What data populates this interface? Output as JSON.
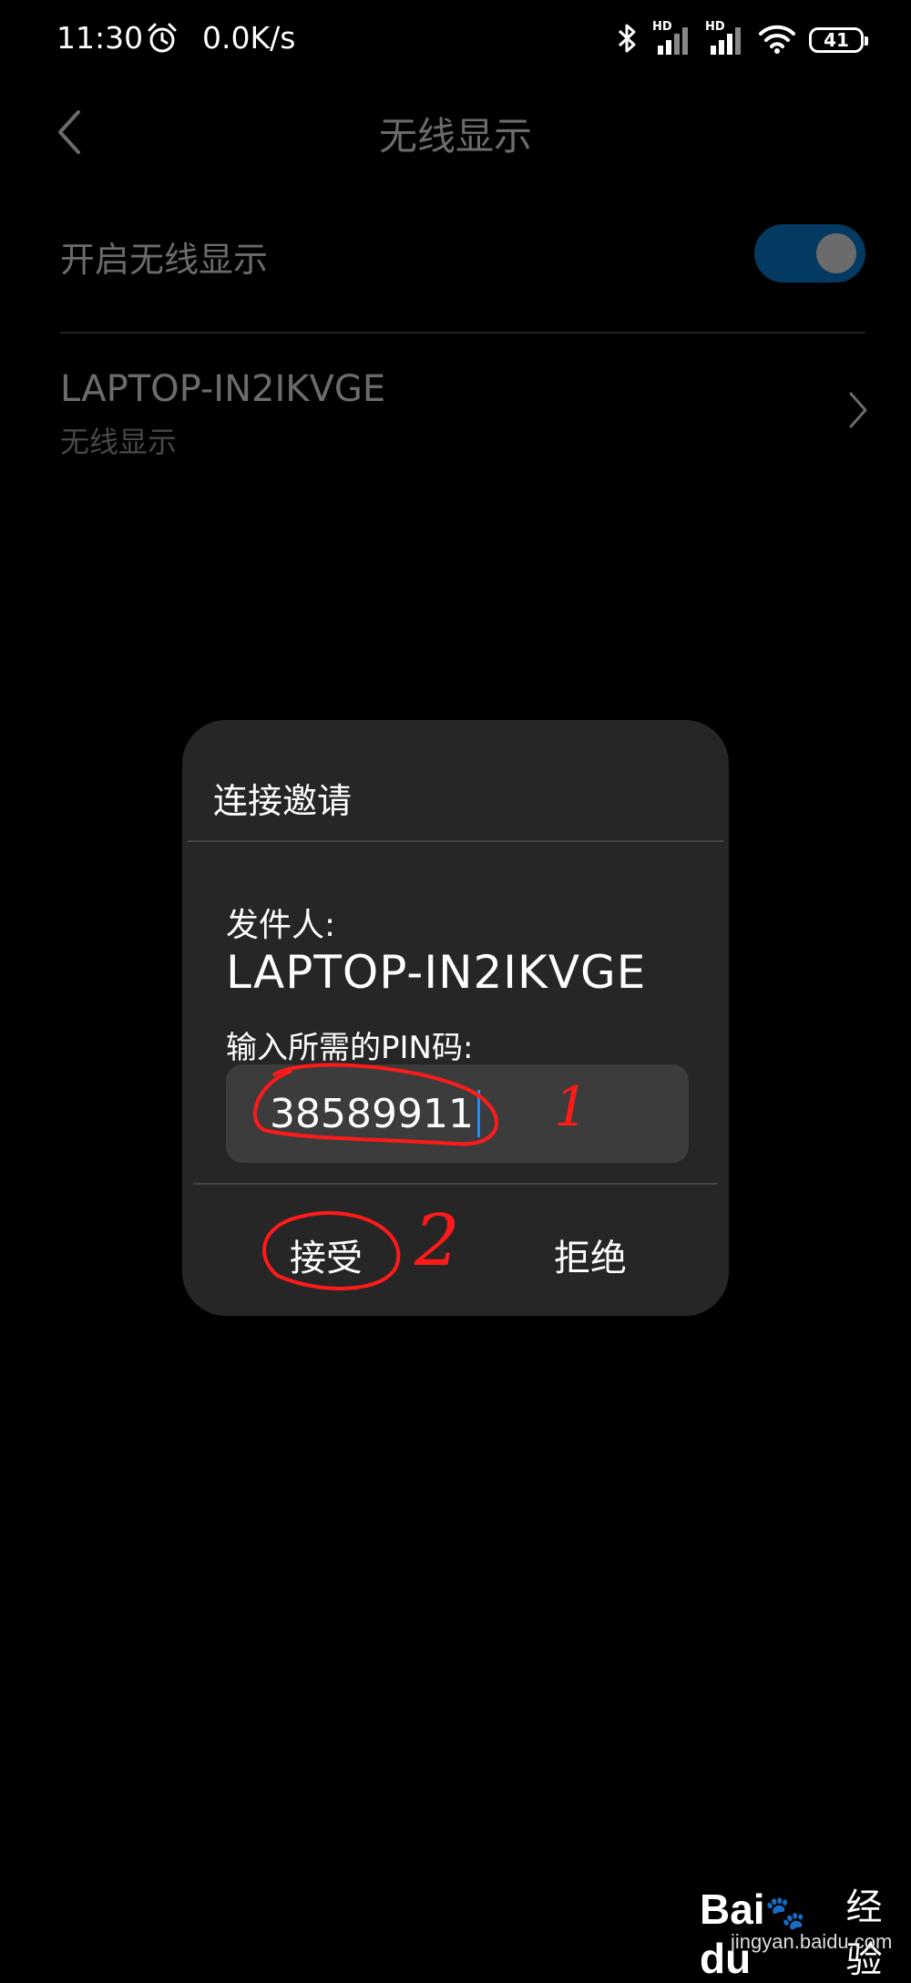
{
  "status_bar": {
    "time": "11:30",
    "speed": "0.0K/s",
    "signal1_tag": "HD",
    "signal2_tag": "HD",
    "battery": "41"
  },
  "header": {
    "title": "无线显示"
  },
  "settings": {
    "wireless_display_label": "开启无线显示",
    "toggle_on": true,
    "accent_color": "#0a8ae8"
  },
  "device": {
    "name": "LAPTOP-IN2IKVGE",
    "subtitle": "无线显示"
  },
  "dialog": {
    "title": "连接邀请",
    "sender_label": "发件人:",
    "sender_name": "LAPTOP-IN2IKVGE",
    "pin_label": "输入所需的PIN码:",
    "pin_value": "38589911",
    "accept_label": "接受",
    "reject_label": "拒绝"
  },
  "annotations": {
    "mark1": "1",
    "mark2": "2",
    "color": "#ff1a1a"
  },
  "watermark": {
    "logo": "Bai",
    "logo_end": "du",
    "brand": "经验",
    "url": "jingyan.baidu.com"
  }
}
